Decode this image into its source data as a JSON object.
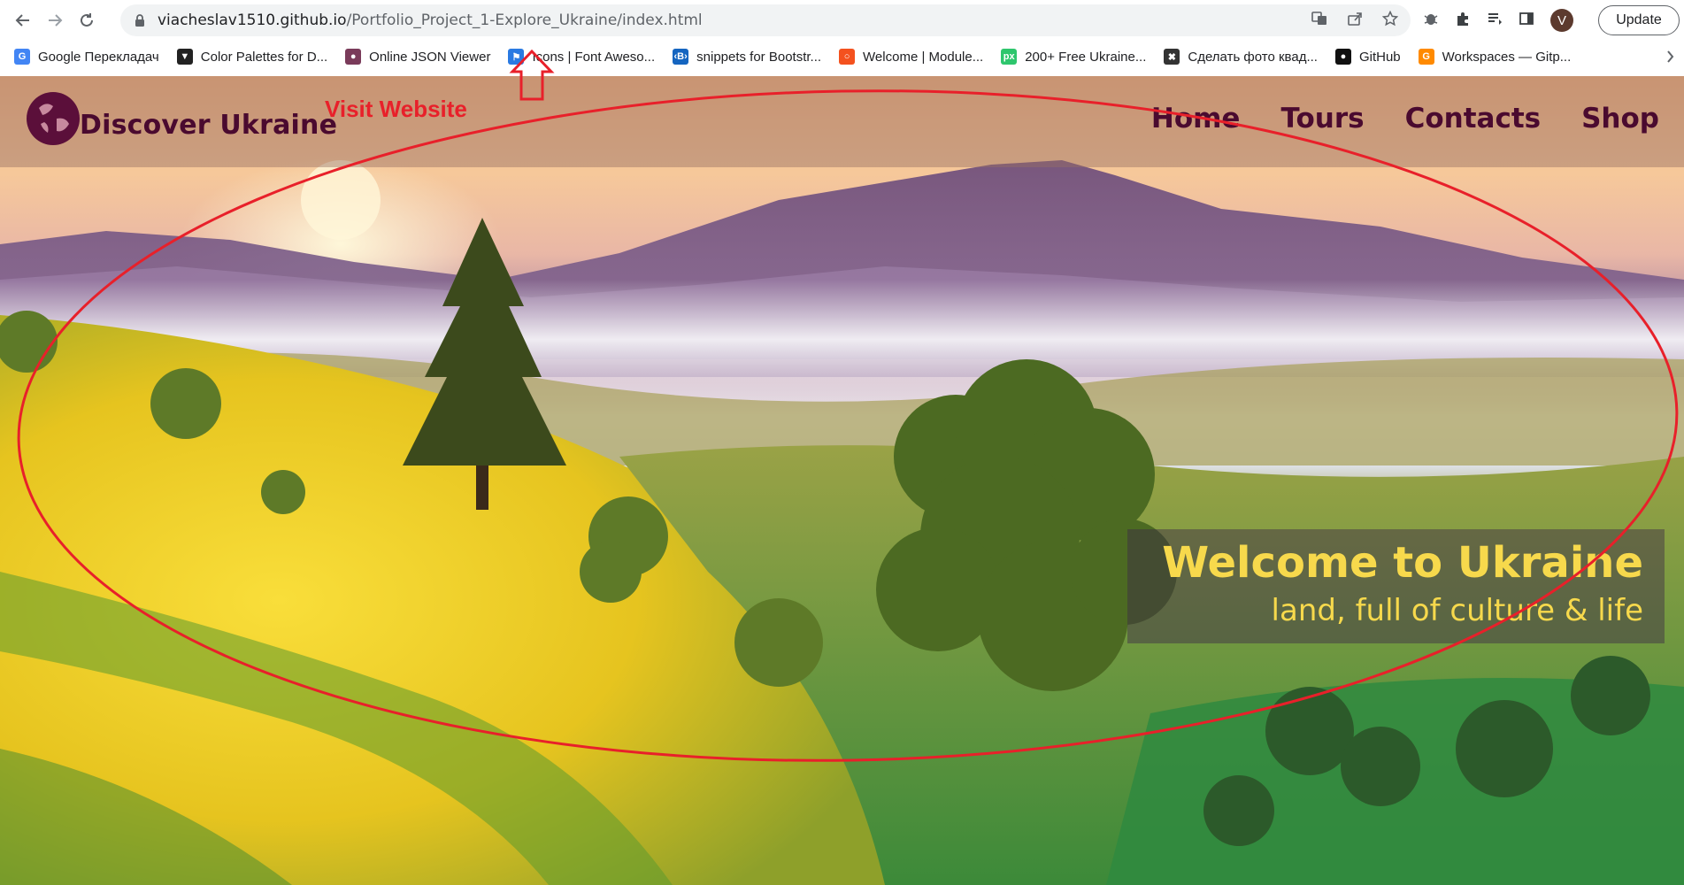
{
  "browser": {
    "url_host": "viacheslav1510.github.io",
    "url_path": "/Portfolio_Project_1-Explore_Ukraine/index.html",
    "avatar_letter": "V",
    "update_label": "Update"
  },
  "bookmarks": [
    {
      "label": "Google Перекладач",
      "icon": "google-translate-icon",
      "color": "#4285f4",
      "glyph": "G"
    },
    {
      "label": "Color Palettes for D...",
      "icon": "color-palettes-icon",
      "color": "#222222",
      "glyph": "▼"
    },
    {
      "label": "Online JSON Viewer",
      "icon": "json-viewer-icon",
      "color": "#7a3b5a",
      "glyph": "●"
    },
    {
      "label": "Icons | Font Aweso...",
      "icon": "font-awesome-flag-icon",
      "color": "#2a7ae2",
      "glyph": "⚑"
    },
    {
      "label": "snippets for Bootstr...",
      "icon": "bootstrap-snippets-icon",
      "color": "#1565c0",
      "glyph": "‹B›"
    },
    {
      "label": "Welcome | Module...",
      "icon": "module-icon",
      "color": "#f4511e",
      "glyph": "○"
    },
    {
      "label": "200+ Free Ukraine...",
      "icon": "pixabay-icon",
      "color": "#2ec66d",
      "glyph": "px"
    },
    {
      "label": "Сделать фото квад...",
      "icon": "tools-icon",
      "color": "#333333",
      "glyph": "✖"
    },
    {
      "label": "GitHub",
      "icon": "github-icon",
      "color": "#111111",
      "glyph": "●"
    },
    {
      "label": "Workspaces — Gitp...",
      "icon": "gitpod-icon",
      "color": "#ff8a00",
      "glyph": "G"
    }
  ],
  "site": {
    "brand": "Discover Ukraine",
    "nav": [
      "Home",
      "Tours",
      "Contacts",
      "Shop"
    ],
    "hero_title": "Welcome to Ukraine",
    "hero_subtitle": "land, full of culture & life"
  },
  "annotation": {
    "label": "Visit Website",
    "color": "#e8202a"
  }
}
